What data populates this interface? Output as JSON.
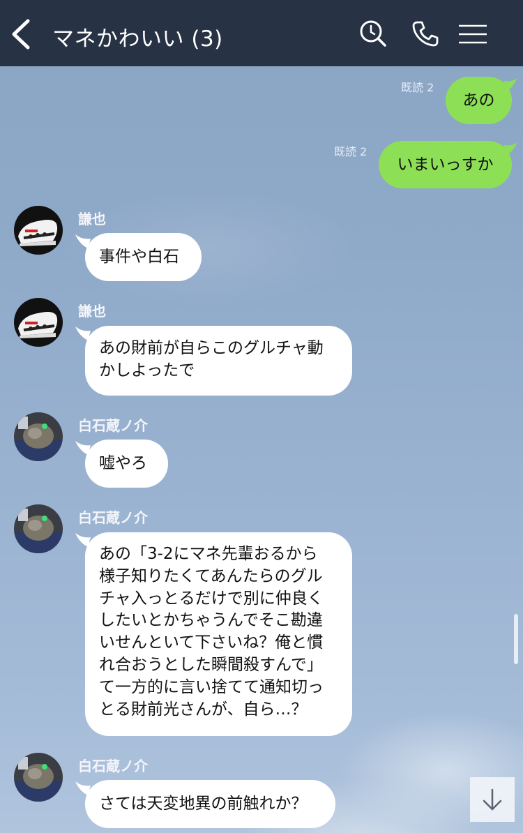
{
  "header": {
    "title": "マネかわいい (3)",
    "back_icon": "chevron-left-icon",
    "search_icon": "search-icon",
    "call_icon": "phone-icon",
    "menu_icon": "menu-icon"
  },
  "messages": {
    "out1": {
      "text": "あの",
      "read": "既読 2"
    },
    "out2": {
      "text": "いまいっすか",
      "read": "既読 2"
    },
    "in1": {
      "sender": "謙也",
      "lines": [
        "事件や白石"
      ]
    },
    "in2": {
      "sender": "謙也",
      "lines": [
        "あの財前が自らこのグルチャ動",
        "かしよったで"
      ]
    },
    "in3": {
      "sender": "白石蔵ノ介",
      "lines": [
        "嘘やろ"
      ]
    },
    "in4": {
      "sender": "白石蔵ノ介",
      "lines": [
        "あの「3-2にマネ先輩おるから",
        "様子知りたくてあんたらのグル",
        "チャ入っとるだけで別に仲良く",
        "したいとかちゃうんでそこ勘違",
        "いせんといて下さいね？俺と慣",
        "れ合おうとした瞬間殺すんで」",
        "て一方的に言い捨てて通知切っ",
        "とる財前光さんが、自ら…？"
      ]
    },
    "in5": {
      "sender": "白石蔵ノ介",
      "lines": [
        "さては天変地異の前触れか？"
      ]
    }
  },
  "colors": {
    "header_bg": "#273244",
    "outgoing_bubble": "#8de055",
    "incoming_bubble": "#ffffff"
  },
  "scroll_down_icon": "arrow-down-icon"
}
